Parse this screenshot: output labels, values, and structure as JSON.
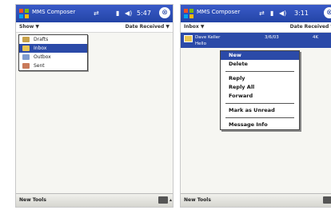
{
  "colors": {
    "title_bar": "#2344a6",
    "selection": "#2b4aa8",
    "background": "#f2f2ee"
  },
  "left_screen": {
    "title": "MMS Composer",
    "status_time": "5:47",
    "ok_label": "ok",
    "filter_left": "Show ▼",
    "filter_right": "Date Received ▼",
    "folders": [
      {
        "label": "Drafts",
        "icon": "drafts-folder-icon",
        "icon_color": "#c9a24a"
      },
      {
        "label": "Inbox",
        "icon": "inbox-folder-icon",
        "icon_color": "#e8c450"
      },
      {
        "label": "Outbox",
        "icon": "outbox-folder-icon",
        "icon_color": "#7f9ccf"
      },
      {
        "label": "Sent",
        "icon": "sent-folder-icon",
        "icon_color": "#c97a5a"
      }
    ],
    "selected_folder": "Inbox",
    "bottom_menu": "New Tools"
  },
  "right_screen": {
    "title": "MMS Composer",
    "status_time": "3:11",
    "ok_label": "ok",
    "filter_left": "Inbox ▼",
    "filter_right": "Date Received ▼",
    "message": {
      "from": "Dave Keller",
      "date": "3/6/03",
      "size": "4K",
      "subject": "Hello"
    },
    "context_menu": [
      {
        "label": "New",
        "highlight": true
      },
      {
        "label": "Delete"
      },
      {
        "separator": true
      },
      {
        "label": "Reply"
      },
      {
        "label": "Reply All"
      },
      {
        "label": "Forward"
      },
      {
        "separator": true
      },
      {
        "label": "Mark as Unread"
      },
      {
        "separator": true
      },
      {
        "label": "Message Info"
      }
    ],
    "bottom_menu": "New Tools"
  }
}
